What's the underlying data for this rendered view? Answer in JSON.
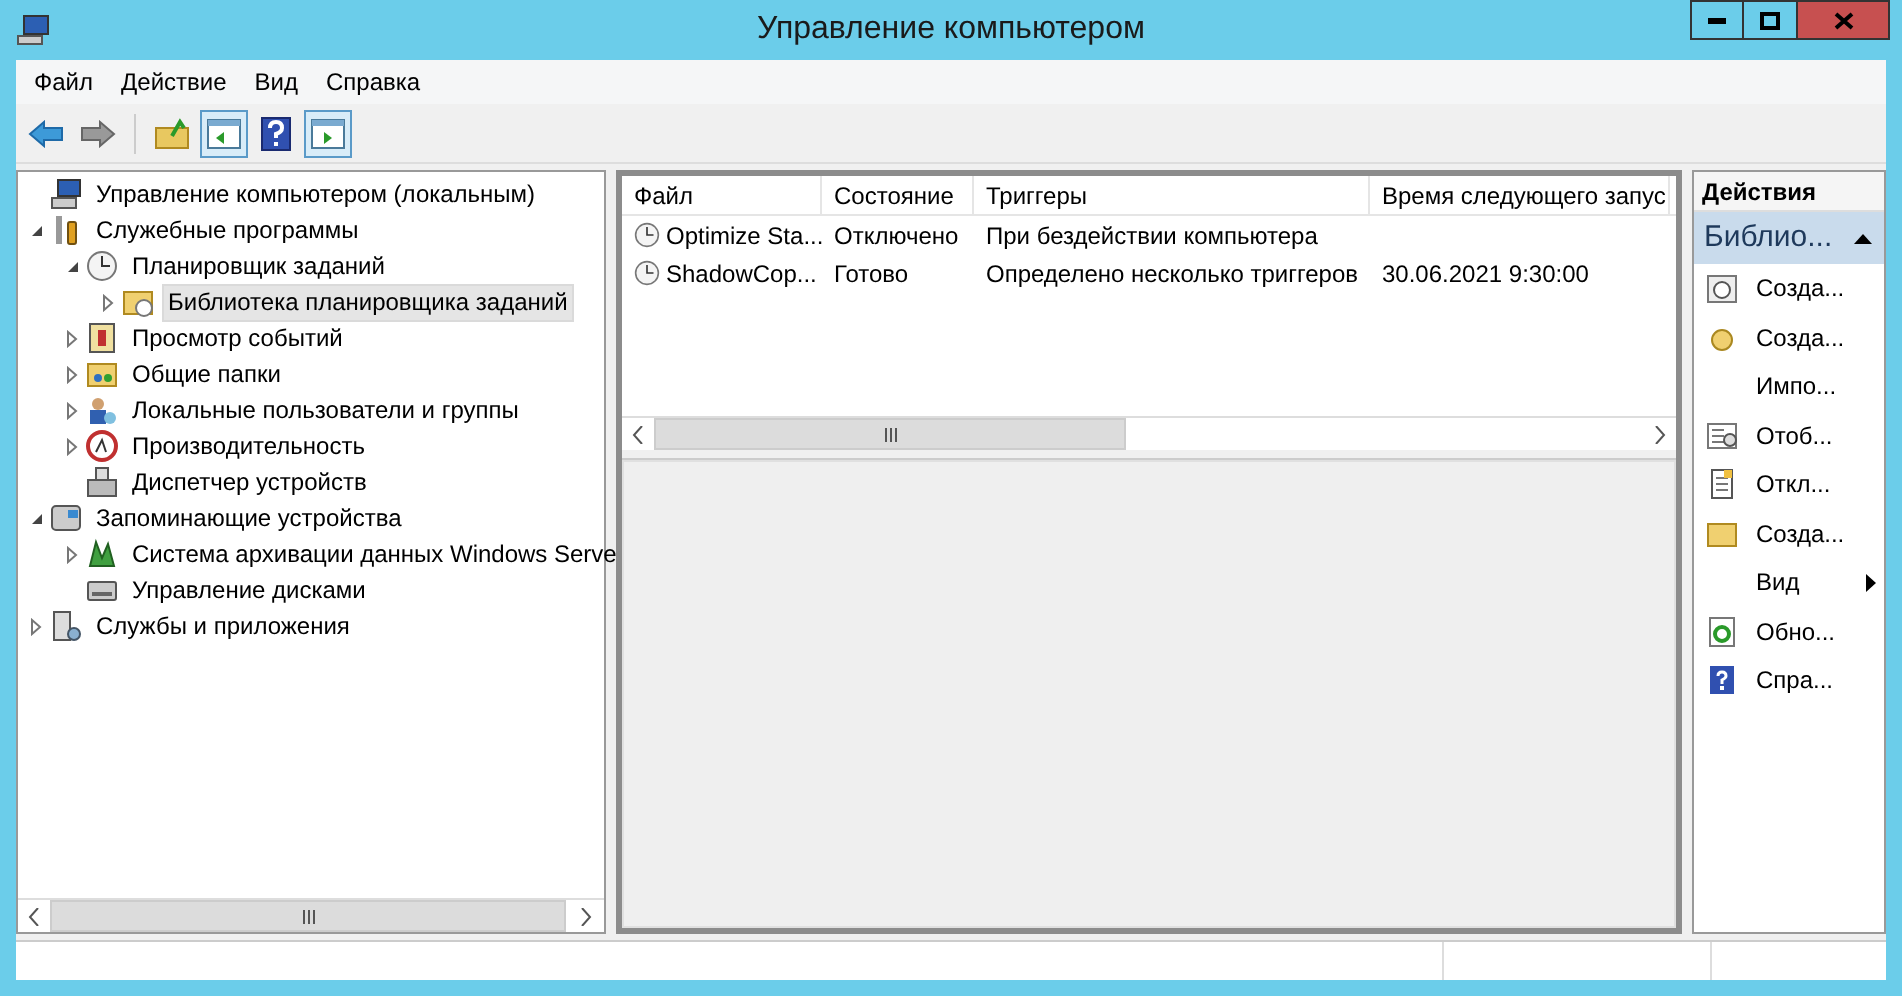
{
  "window": {
    "title": "Управление компьютером"
  },
  "menu": [
    "Файл",
    "Действие",
    "Вид",
    "Справка"
  ],
  "toolbar": [
    {
      "kind": "back",
      "pressed": false
    },
    {
      "kind": "forward",
      "pressed": false
    },
    {
      "kind": "up",
      "pressed": false
    },
    {
      "kind": "tree",
      "pressed": true
    },
    {
      "kind": "help",
      "pressed": false
    },
    {
      "kind": "actions",
      "pressed": true
    }
  ],
  "tree": [
    {
      "label": "Управление компьютером (локальным)",
      "selected": false,
      "children": [
        {
          "label": "Служебные программы",
          "expanded": true,
          "selected": false,
          "children": [
            {
              "label": "Планировщик заданий",
              "expanded": true,
              "selected": false,
              "children": [
                {
                  "label": "Библиотека планировщика заданий",
                  "expanded": false,
                  "selected": true
                }
              ]
            },
            {
              "label": "Просмотр событий",
              "expanded": false,
              "selected": false
            },
            {
              "label": "Общие папки",
              "expanded": false,
              "selected": false
            },
            {
              "label": "Локальные пользователи и группы",
              "expanded": false,
              "selected": false
            },
            {
              "label": "Производительность",
              "expanded": false,
              "selected": false
            },
            {
              "label": "Диспетчер устройств",
              "selected": false
            }
          ]
        },
        {
          "label": "Запоминающие устройства",
          "expanded": true,
          "selected": false,
          "children": [
            {
              "label": "Система архивации данных Windows Serve",
              "expanded": false,
              "selected": false
            },
            {
              "label": "Управление дисками",
              "selected": false
            }
          ]
        },
        {
          "label": "Службы и приложения",
          "expanded": false,
          "selected": false
        }
      ]
    }
  ],
  "table": {
    "columns": [
      "Файл",
      "Состояние",
      "Триггеры",
      "Время следующего запус"
    ],
    "rows": [
      {
        "file": "Optimize Sta...",
        "status": "Отключено",
        "triggers": "При бездействии компьютера"
      },
      {
        "file": "ShadowCop...",
        "status": "Готово",
        "triggers": "Определено несколько триггеров",
        "next_run": "30.06.2021 9:30:00"
      }
    ]
  },
  "actions": {
    "title": "Действия",
    "section": {
      "label": "Библио...",
      "expanded": true
    },
    "items": [
      {
        "label": "Созда...",
        "kind": "item"
      },
      {
        "label": "Созда...",
        "kind": "item"
      },
      {
        "label": "Импо...",
        "kind": "item"
      },
      {
        "label": "Отоб...",
        "kind": "item"
      },
      {
        "label": "Откл...",
        "kind": "item"
      },
      {
        "label": "Созда...",
        "kind": "item"
      },
      {
        "label": "Вид",
        "kind": "submenu"
      },
      {
        "label": "Обно...",
        "kind": "item"
      },
      {
        "label": "Спра...",
        "kind": "item"
      }
    ]
  }
}
